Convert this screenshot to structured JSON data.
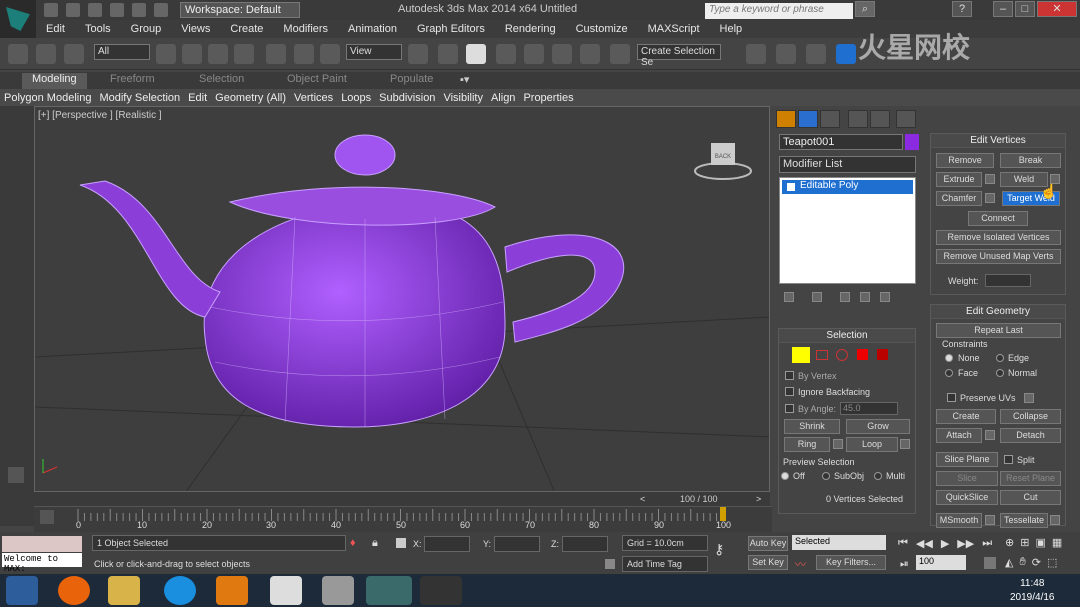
{
  "window": {
    "workspace": "Workspace: Default",
    "title": "Autodesk 3ds Max  2014 x64      Untitled",
    "search_placeholder": "Type a keyword or phrase"
  },
  "menu": [
    "Edit",
    "Tools",
    "Group",
    "Views",
    "Create",
    "Modifiers",
    "Animation",
    "Graph Editors",
    "Rendering",
    "Customize",
    "MAXScript",
    "Help"
  ],
  "toolbar": {
    "selection_filter": "All",
    "ref_coord": "View",
    "named_selection": "Create Selection Se"
  },
  "ribbon": {
    "tabs": [
      "Modeling",
      "Freeform",
      "Selection",
      "Object Paint",
      "Populate"
    ],
    "items": [
      "Polygon Modeling",
      "Modify Selection",
      "Edit",
      "Geometry (All)",
      "Vertices",
      "Loops",
      "Subdivision",
      "Visibility",
      "Align",
      "Properties"
    ]
  },
  "viewport": {
    "label": "[+] [Perspective ] [Realistic ]",
    "viewcube_label": "BACK"
  },
  "command_panel": {
    "object_name": "Teapot001",
    "object_color": "#8a2be2",
    "modifier_list": "Modifier List",
    "stack_item": "Editable Poly",
    "selection": {
      "title": "Selection",
      "by_vertex": "By Vertex",
      "ignore_backfacing": "Ignore Backfacing",
      "by_angle": "By Angle:",
      "angle_value": "45.0",
      "shrink": "Shrink",
      "grow": "Grow",
      "ring": "Ring",
      "loop": "Loop",
      "preview_title": "Preview Selection",
      "preview_off": "Off",
      "preview_subobj": "SubObj",
      "preview_multi": "Multi",
      "status": "0 Vertices Selected"
    },
    "edit_vertices": {
      "title": "Edit Vertices",
      "remove": "Remove",
      "break": "Break",
      "extrude": "Extrude",
      "weld": "Weld",
      "chamfer": "Chamfer",
      "target_weld": "Target Weld",
      "connect": "Connect",
      "remove_isolated": "Remove Isolated Vertices",
      "remove_unused": "Remove Unused Map Verts",
      "weight": "Weight:"
    },
    "edit_geometry": {
      "title": "Edit Geometry",
      "repeat_last": "Repeat Last",
      "constraints": "Constraints",
      "none": "None",
      "edge": "Edge",
      "face": "Face",
      "normal": "Normal",
      "preserve_uvs": "Preserve UVs",
      "create": "Create",
      "collapse": "Collapse",
      "attach": "Attach",
      "detach": "Detach",
      "slice_plane": "Slice Plane",
      "split": "Split",
      "slice": "Slice",
      "reset_plane": "Reset Plane",
      "quickslice": "QuickSlice",
      "cut": "Cut",
      "msmooth": "MSmooth",
      "tessellate": "Tessellate"
    }
  },
  "timeline": {
    "frame_display": "100 / 100",
    "ticks": [
      "0",
      "10",
      "20",
      "30",
      "40",
      "50",
      "60",
      "70",
      "80",
      "90",
      "100"
    ]
  },
  "status": {
    "maxscript": "Welcome to MAX:",
    "objects_selected": "1 Object Selected",
    "prompt": "Click or click-and-drag to select objects",
    "x_label": "X:",
    "y_label": "Y:",
    "z_label": "Z:",
    "grid": "Grid = 10.0cm",
    "add_time_tag": "Add Time Tag",
    "auto_key": "Auto Key",
    "set_key": "Set Key",
    "key_mode": "Selected",
    "key_filters": "Key Filters...",
    "current_frame": "100"
  },
  "taskbar": {
    "time": "11:48",
    "date": "2019/4/16"
  },
  "watermark": "火星网校"
}
